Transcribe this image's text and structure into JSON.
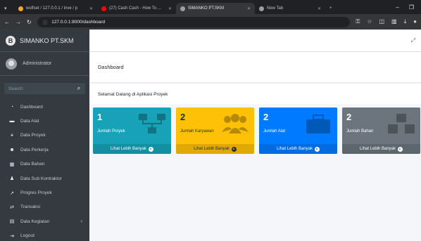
{
  "browser": {
    "tabs": [
      {
        "title": "wolfset / 127.0.0.1 / inve / p",
        "color": "#f9a825"
      },
      {
        "title": "(27) Cash Cash - How To ...",
        "color": "#ff0000"
      },
      {
        "title": "SIMANKO PT.SKM",
        "color": "#9aa0a6"
      },
      {
        "title": "New Tab",
        "color": "#9aa0a6"
      }
    ],
    "url": "127.0.0.1:8000/dashboard"
  },
  "sidebar": {
    "brand": "SIMANKO PT.SKM",
    "brand_logo": "B",
    "user": "Administrator",
    "search_placeholder": "Search",
    "items": [
      {
        "label": "Dashboard",
        "icon": "dashboard-icon",
        "glyph": "◔"
      },
      {
        "label": "Data Alat",
        "icon": "toolbox-icon",
        "glyph": "▬"
      },
      {
        "label": "Data Proyek",
        "icon": "project-diagram-icon",
        "glyph": "⚹"
      },
      {
        "label": "Data Perkerja",
        "icon": "users-icon",
        "glyph": "☻"
      },
      {
        "label": "Data Bahan",
        "icon": "cubes-icon",
        "glyph": "▦"
      },
      {
        "label": "Data Sub Kontraktor",
        "icon": "user-tie-icon",
        "glyph": "♟"
      },
      {
        "label": "Progres Proyek",
        "icon": "chart-line-icon",
        "glyph": "↗"
      },
      {
        "label": "Transaksi",
        "icon": "exchange-icon",
        "glyph": "⇄"
      },
      {
        "label": "Data Kegiatan",
        "icon": "book-icon",
        "glyph": "▤"
      },
      {
        "label": "Logout",
        "icon": "logout-icon",
        "glyph": "⇥"
      }
    ]
  },
  "content": {
    "page_title": "Dashboard",
    "welcome": "Selamat Datang di Aplikasi Proyek",
    "cards": [
      {
        "count": "1",
        "label": "Jumlah Proyek",
        "more": "Lihat Lebih Banyak",
        "color": "#17a2b8",
        "text_color": "#ffffff",
        "icon": "project-diagram-icon"
      },
      {
        "count": "2",
        "label": "Jumlah Karyawan",
        "more": "Lihat Lebih Banyak",
        "color": "#ffc107",
        "text_color": "#1f2d3d",
        "icon": "users-icon"
      },
      {
        "count": "2",
        "label": "Jumlah Alat",
        "more": "Lihat Lebih Banyak",
        "color": "#007bff",
        "text_color": "#ffffff",
        "icon": "toolbox-icon"
      },
      {
        "count": "2",
        "label": "Jumlah Bahan",
        "more": "Lihat Lebih Banyak",
        "color": "#6c757d",
        "text_color": "#ffffff",
        "icon": "cubes-icon"
      }
    ]
  }
}
